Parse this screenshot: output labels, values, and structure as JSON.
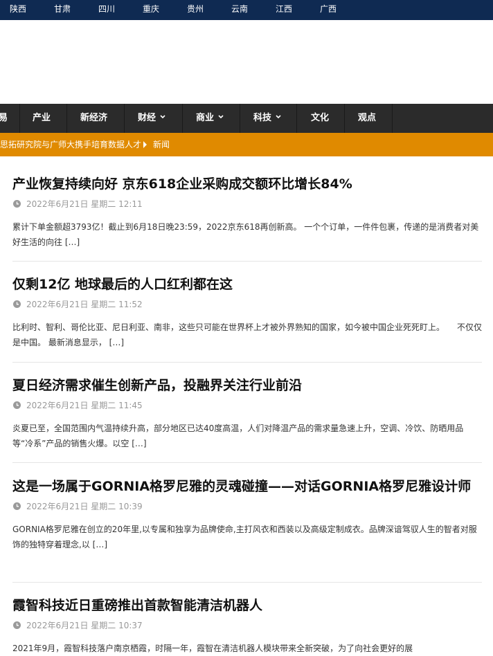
{
  "regions": [
    "陕西",
    "甘肃",
    "四川",
    "重庆",
    "贵州",
    "云南",
    "江西",
    "广西"
  ],
  "nav": {
    "items": [
      {
        "label": "易",
        "dropdown": false
      },
      {
        "label": "产业",
        "dropdown": false
      },
      {
        "label": "新经济",
        "dropdown": false
      },
      {
        "label": "财经",
        "dropdown": true
      },
      {
        "label": "商业",
        "dropdown": true
      },
      {
        "label": "科技",
        "dropdown": true
      },
      {
        "label": "文化",
        "dropdown": false
      },
      {
        "label": "观点",
        "dropdown": false
      }
    ]
  },
  "ticker": {
    "headline": "思拓研究院与广师大携手培育数据人才",
    "tag": "新闻"
  },
  "articles": [
    {
      "title": "产业恢复持续向好 京东618企业采购成交额环比增长84%",
      "date": "2022年6月21日 星期二 12:11",
      "excerpt": "累计下单金额超3793亿！截止到6月18日晚23:59，2022京东618再创新高。 一个个订单，一件件包裹，传递的是消费者对美好生活的向往 ",
      "more": "[…]"
    },
    {
      "title": "仅剩12亿 地球最后的人口红利都在这",
      "date": "2022年6月21日 星期二 11:52",
      "excerpt": "比利时、智利、哥伦比亚、尼日利亚、南非，这些只可能在世界杯上才被外界熟知的国家，如今被中国企业死死盯上。　　不仅仅是中国。 最新消息显示， ",
      "more": "[…]"
    },
    {
      "title": "夏日经济需求催生创新产品，投融界关注行业前沿",
      "date": "2022年6月21日 星期二 11:45",
      "excerpt": "炎夏已至，全国范围内气温持续升高，部分地区已达40度高温，人们对降温产品的需求量急速上升，空调、冷饮、防晒用品等“冷系”产品的销售火爆。以空 ",
      "more": "[…]"
    },
    {
      "title": "这是一场属于GORNIA格罗尼雅的灵魂碰撞——对话GORNIA格罗尼雅设计师",
      "date": "2022年6月21日 星期二 10:39",
      "excerpt": "GORNIA格罗尼雅在创立的20年里,以专属和独享为品牌使命,主打风衣和西装以及高级定制成衣。品牌深谙驾驭人生的智者对服饰的独特穿着理念,以 ",
      "more": "[…]"
    },
    {
      "title": "霞智科技近日重磅推出首款智能清洁机器人",
      "date": "2022年6月21日 星期二 10:37",
      "excerpt": "2021年9月，霞智科技落户南京栖霞，时隔一年，霞智在清洁机器人模块带来全新突破，为了向社会更好的展",
      "more": ""
    }
  ],
  "colors": {
    "topbar": "#0f2a52",
    "navbar": "#2b2b2b",
    "ticker": "#e08a00"
  }
}
